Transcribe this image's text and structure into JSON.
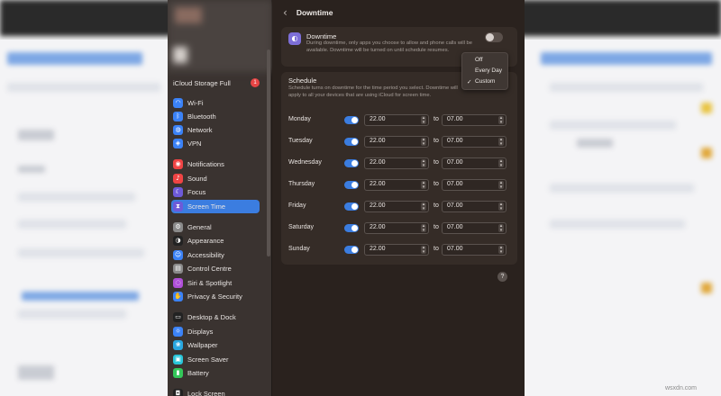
{
  "sidebar": {
    "icloud": {
      "label": "iCloud Storage Full",
      "badge": "1"
    },
    "items": [
      {
        "label": "Wi-Fi",
        "icon": "wifi-icon",
        "color": "#3b82f6",
        "active": false
      },
      {
        "label": "Bluetooth",
        "icon": "bluetooth-icon",
        "color": "#3b82f6",
        "active": false
      },
      {
        "label": "Network",
        "icon": "globe-icon",
        "color": "#3b82f6",
        "active": false
      },
      {
        "label": "VPN",
        "icon": "vpn-icon",
        "color": "#3b82f6",
        "active": false
      },
      {
        "label": "Notifications",
        "icon": "bell-icon",
        "color": "#ef4444",
        "active": false
      },
      {
        "label": "Sound",
        "icon": "speaker-icon",
        "color": "#ef4444",
        "active": false
      },
      {
        "label": "Focus",
        "icon": "moon-icon",
        "color": "#6d5ad8",
        "active": false
      },
      {
        "label": "Screen Time",
        "icon": "hourglass-icon",
        "color": "#6d5ad8",
        "active": true
      },
      {
        "label": "General",
        "icon": "gear-icon",
        "color": "#8a8a8a",
        "active": false
      },
      {
        "label": "Appearance",
        "icon": "appearance-icon",
        "color": "#222222",
        "active": false
      },
      {
        "label": "Accessibility",
        "icon": "accessibility-icon",
        "color": "#3b82f6",
        "active": false
      },
      {
        "label": "Control Centre",
        "icon": "control-centre-icon",
        "color": "#8a8a8a",
        "active": false
      },
      {
        "label": "Siri & Spotlight",
        "icon": "siri-icon",
        "color": "#b04fd8",
        "active": false
      },
      {
        "label": "Privacy & Security",
        "icon": "hand-icon",
        "color": "#3b82f6",
        "active": false
      },
      {
        "label": "Desktop & Dock",
        "icon": "dock-icon",
        "color": "#222222",
        "active": false
      },
      {
        "label": "Displays",
        "icon": "display-icon",
        "color": "#3b82f6",
        "active": false
      },
      {
        "label": "Wallpaper",
        "icon": "wallpaper-icon",
        "color": "#29a7e0",
        "active": false
      },
      {
        "label": "Screen Saver",
        "icon": "screensaver-icon",
        "color": "#29c5d8",
        "active": false
      },
      {
        "label": "Battery",
        "icon": "battery-icon",
        "color": "#34c759",
        "active": false
      },
      {
        "label": "Lock Screen",
        "icon": "lock-icon",
        "color": "#222222",
        "active": false
      }
    ]
  },
  "header": {
    "title": "Downtime"
  },
  "downtime": {
    "title": "Downtime",
    "description": "During downtime, only apps you choose to allow and phone calls will be available. Downtime will be turned on until schedule resumes.",
    "enabled": false
  },
  "menu": {
    "options": [
      "Off",
      "Every Day",
      "Custom"
    ],
    "selected": "Custom"
  },
  "schedule": {
    "title": "Schedule",
    "description": "Schedule turns on downtime for the time period you select. Downtime will apply to all your devices that are using iCloud for screen time.",
    "to_label": "to",
    "days": [
      {
        "day": "Monday",
        "enabled": true,
        "from": "22.00",
        "to": "07.00"
      },
      {
        "day": "Tuesday",
        "enabled": true,
        "from": "22.00",
        "to": "07.00"
      },
      {
        "day": "Wednesday",
        "enabled": true,
        "from": "22.00",
        "to": "07.00"
      },
      {
        "day": "Thursday",
        "enabled": true,
        "from": "22.00",
        "to": "07.00"
      },
      {
        "day": "Friday",
        "enabled": true,
        "from": "22.00",
        "to": "07.00"
      },
      {
        "day": "Saturday",
        "enabled": true,
        "from": "22.00",
        "to": "07.00"
      },
      {
        "day": "Sunday",
        "enabled": true,
        "from": "22.00",
        "to": "07.00"
      }
    ]
  },
  "help": {
    "label": "?"
  },
  "watermark": "wsxdn.com"
}
